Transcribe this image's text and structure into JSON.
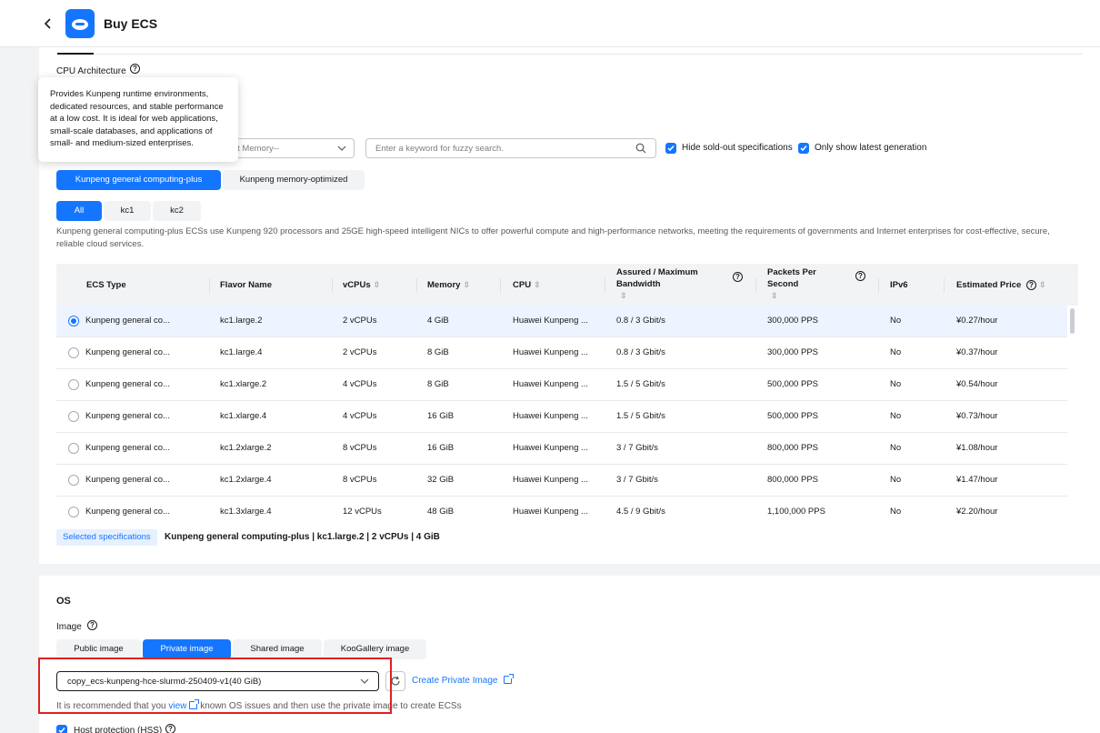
{
  "header": {
    "title": "Buy ECS"
  },
  "cpu_architecture": {
    "label": "CPU Architecture"
  },
  "tooltip": {
    "text": "Provides Kunpeng runtime environments, dedicated resources, and stable performance at a low cost. It is ideal for web applications, small-scale databases, and applications of small- and medium-sized enterprises."
  },
  "filters": {
    "memory_placeholder": "lect Memory--",
    "search_placeholder": "Enter a keyword for fuzzy search.",
    "hide_sold_out": "Hide sold-out specifications",
    "only_latest": "Only show latest generation"
  },
  "type_tabs": [
    "Kunpeng general computing-plus",
    "Kunpeng memory-optimized"
  ],
  "gen_tabs": [
    "All",
    "kc1",
    "kc2"
  ],
  "description": "Kunpeng general computing-plus ECSs use Kunpeng 920 processors and 25GE high-speed intelligent NICs to offer powerful compute and high-performance networks, meeting the requirements of governments and Internet enterprises for cost-effective, secure, reliable cloud services.",
  "table": {
    "headers": {
      "type": "ECS Type",
      "flavor": "Flavor Name",
      "vcpus": "vCPUs",
      "memory": "Memory",
      "cpu": "CPU",
      "bandwidth_1": "Assured / Maximum",
      "bandwidth_2": "Bandwidth",
      "pps_1": "Packets Per",
      "pps_2": "Second",
      "ipv6": "IPv6",
      "price": "Estimated Price"
    },
    "rows": [
      {
        "type": "Kunpeng general co...",
        "flavor": "kc1.large.2",
        "vcpus": "2 vCPUs",
        "memory": "4 GiB",
        "cpu": "Huawei Kunpeng ...",
        "bandwidth": "0.8 / 3 Gbit/s",
        "pps": "300,000 PPS",
        "ipv6": "No",
        "price": "¥0.27/hour"
      },
      {
        "type": "Kunpeng general co...",
        "flavor": "kc1.large.4",
        "vcpus": "2 vCPUs",
        "memory": "8 GiB",
        "cpu": "Huawei Kunpeng ...",
        "bandwidth": "0.8 / 3 Gbit/s",
        "pps": "300,000 PPS",
        "ipv6": "No",
        "price": "¥0.37/hour"
      },
      {
        "type": "Kunpeng general co...",
        "flavor": "kc1.xlarge.2",
        "vcpus": "4 vCPUs",
        "memory": "8 GiB",
        "cpu": "Huawei Kunpeng ...",
        "bandwidth": "1.5 / 5 Gbit/s",
        "pps": "500,000 PPS",
        "ipv6": "No",
        "price": "¥0.54/hour"
      },
      {
        "type": "Kunpeng general co...",
        "flavor": "kc1.xlarge.4",
        "vcpus": "4 vCPUs",
        "memory": "16 GiB",
        "cpu": "Huawei Kunpeng ...",
        "bandwidth": "1.5 / 5 Gbit/s",
        "pps": "500,000 PPS",
        "ipv6": "No",
        "price": "¥0.73/hour"
      },
      {
        "type": "Kunpeng general co...",
        "flavor": "kc1.2xlarge.2",
        "vcpus": "8 vCPUs",
        "memory": "16 GiB",
        "cpu": "Huawei Kunpeng ...",
        "bandwidth": "3 / 7 Gbit/s",
        "pps": "800,000 PPS",
        "ipv6": "No",
        "price": "¥1.08/hour"
      },
      {
        "type": "Kunpeng general co...",
        "flavor": "kc1.2xlarge.4",
        "vcpus": "8 vCPUs",
        "memory": "32 GiB",
        "cpu": "Huawei Kunpeng ...",
        "bandwidth": "3 / 7 Gbit/s",
        "pps": "800,000 PPS",
        "ipv6": "No",
        "price": "¥1.47/hour"
      },
      {
        "type": "Kunpeng general co...",
        "flavor": "kc1.3xlarge.4",
        "vcpus": "12 vCPUs",
        "memory": "48 GiB",
        "cpu": "Huawei Kunpeng ...",
        "bandwidth": "4.5 / 9 Gbit/s",
        "pps": "1,100,000 PPS",
        "ipv6": "No",
        "price": "¥2.20/hour"
      }
    ]
  },
  "selected": {
    "badge": "Selected specifications",
    "text": "Kunpeng general computing-plus | kc1.large.2 | 2 vCPUs | 4 GiB"
  },
  "os": {
    "title": "OS",
    "image_label": "Image",
    "image_tabs": [
      "Public image",
      "Private image",
      "Shared image",
      "KooGallery image"
    ],
    "selected_image": "copy_ecs-kunpeng-hce-slurmd-250409-v1(40 GiB)",
    "create_link": "Create Private Image",
    "note_before": "It is recommended that you",
    "note_link": "view",
    "note_after": "known OS issues and then use the private image to create ECSs",
    "host_protection": "Host protection (HSS)"
  },
  "colors": {
    "accent": "#1476ff",
    "highlight": "#e02020"
  }
}
